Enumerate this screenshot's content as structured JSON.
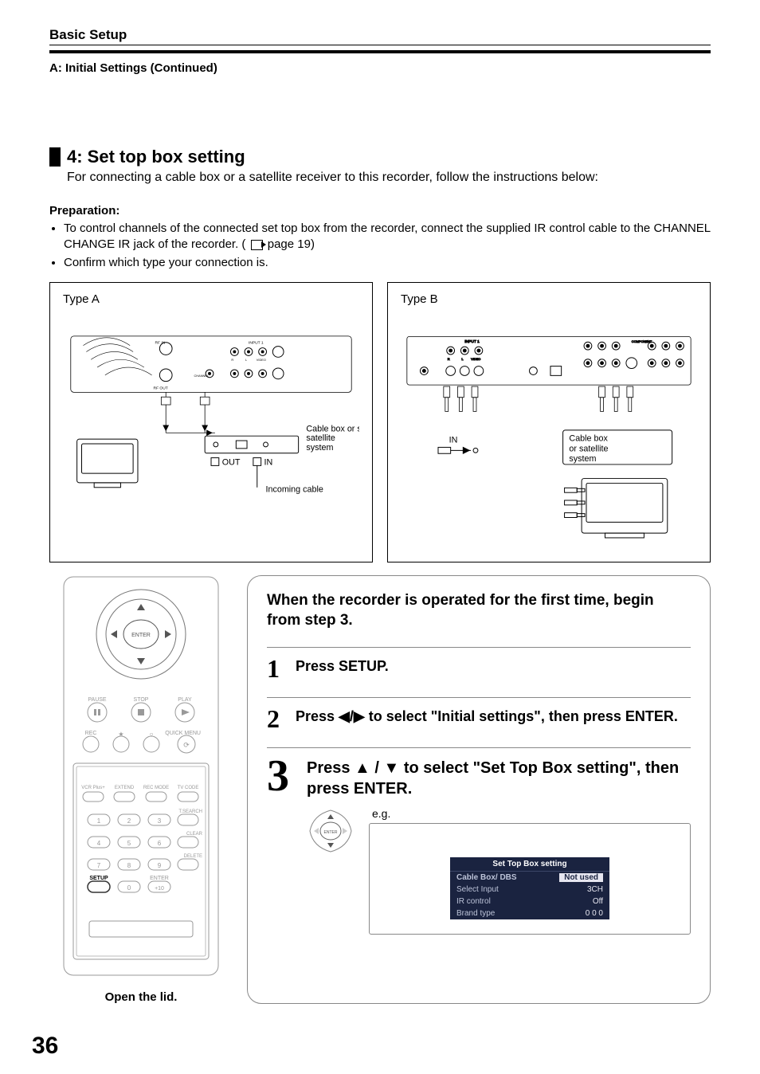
{
  "header": {
    "section": "Basic Setup",
    "subheader": "A: Initial Settings (Continued)"
  },
  "section4": {
    "title": "4: Set top box setting",
    "intro": "For connecting a cable box or a satellite receiver to this recorder, follow the instructions below:"
  },
  "preparation": {
    "title": "Preparation:",
    "bullets": [
      "To control channels of the connected set top box from the recorder, connect the supplied IR control cable to the CHANNEL CHANGE IR jack of the recorder. (",
      "Confirm which type your connection is."
    ],
    "page_ref_text": " page 19)"
  },
  "diagrams": {
    "typeA": {
      "label": "Type A",
      "box": "Cable box or satellite system",
      "out": "OUT",
      "in": "IN",
      "incoming": "Incoming cable"
    },
    "typeB": {
      "label": "Type B",
      "box": "Cable box or satellite system",
      "in": "IN"
    }
  },
  "remote": {
    "caption": "Open the lid.",
    "enter": "ENTER",
    "labels": {
      "pause": "PAUSE",
      "stop": "STOP",
      "play": "PLAY",
      "rec": "REC",
      "quickmenu": "QUICK MENU",
      "vcrplus": "VCR Plus+",
      "extend": "EXTEND",
      "recmode": "REC MODE",
      "tvcode": "TV CODE",
      "tsearch": "T.SEARCH",
      "clear": "CLEAR",
      "delete": "DELETE",
      "setup": "SETUP",
      "enter2": "ENTER",
      "p10": "+10"
    }
  },
  "steps": {
    "first_time": "When the recorder is operated for the first time, begin from step 3.",
    "s1": {
      "num": "1",
      "text": "Press SETUP."
    },
    "s2": {
      "num": "2",
      "text": "Press ◀/▶ to select \"Initial settings\", then press ENTER."
    },
    "s3": {
      "num": "3",
      "text": "Press ▲ / ▼ to select \"Set Top Box setting\", then press ENTER.",
      "eg": "e.g."
    }
  },
  "osd": {
    "title": "Set Top Box setting",
    "rows": [
      {
        "k": "Cable Box/ DBS",
        "v": "Not used",
        "sel": true
      },
      {
        "k": "Select Input",
        "v": "3CH"
      },
      {
        "k": "IR control",
        "v": "Off"
      },
      {
        "k": "Brand type",
        "v": "0 0 0"
      }
    ]
  },
  "page_number": "36"
}
